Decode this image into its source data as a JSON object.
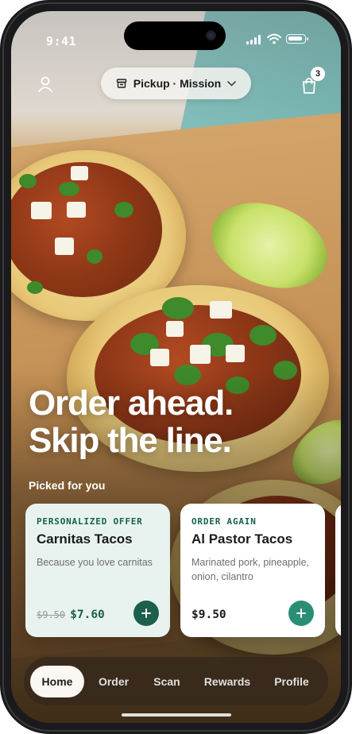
{
  "status_bar": {
    "time": "9:41"
  },
  "header": {
    "location_label": "Pickup · Mission",
    "cart_count": "3"
  },
  "hero": {
    "line1": "Order ahead.",
    "line2": "Skip the line."
  },
  "recommendations": {
    "heading": "Picked for you",
    "cards": [
      {
        "eyebrow": "PERSONALIZED OFFER",
        "title": "Carnitas Tacos",
        "description": "Because you love carnitas",
        "old_price": "$9.50",
        "price": "$7.60"
      },
      {
        "eyebrow": "ORDER AGAIN",
        "title": "Al Pastor Tacos",
        "description": "Marinated pork, pineapple, onion, cilantro",
        "price": "$9.50"
      }
    ]
  },
  "tab_bar": {
    "active": "Home",
    "tabs": [
      {
        "label": "Home"
      },
      {
        "label": "Order"
      },
      {
        "label": "Scan"
      },
      {
        "label": "Rewards"
      },
      {
        "label": "Profile"
      }
    ]
  },
  "colors": {
    "accent_dark_green": "#1c5f4d",
    "accent_green": "#2a8e74",
    "offer_card_bg": "#e8f3ef"
  },
  "icons": {
    "profile": "person-icon",
    "store": "store-icon",
    "chevron": "chevron-down-icon",
    "cart": "shopping-bag-icon",
    "add": "plus-icon"
  }
}
